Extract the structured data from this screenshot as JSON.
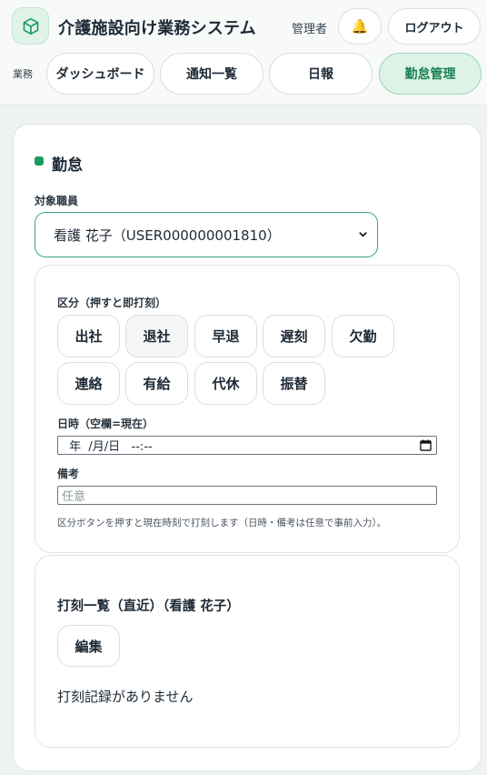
{
  "header": {
    "app_title": "介護施設向け業務システム",
    "role": "管理者",
    "logout_label": "ログアウト",
    "bell_icon": "🔔"
  },
  "nav": {
    "label": "業務",
    "items": [
      {
        "label": "ダッシュボード",
        "active": false
      },
      {
        "label": "通知一覧",
        "active": false
      },
      {
        "label": "日報",
        "active": false
      },
      {
        "label": "勤怠管理",
        "active": true
      }
    ]
  },
  "attendance": {
    "section_title": "勤怠",
    "staff_label": "対象職員",
    "staff_selected": "看護 花子（USER000000001810）",
    "kubun_label": "区分（押すと即打刻）",
    "kubun_buttons": [
      "出社",
      "退社",
      "早退",
      "遅刻",
      "欠勤",
      "連絡",
      "有給",
      "代休",
      "振替"
    ],
    "datetime_label": "日時（空欄=現在）",
    "datetime_value": " 年  /月/日   --:--",
    "memo_label": "備考",
    "memo_placeholder": "任意",
    "hint": "区分ボタンを押すと現在時刻で打刻します（日時・備考は任意で事前入力）。"
  },
  "records": {
    "title": "打刻一覧（直近）（看護 花子）",
    "edit_label": "編集",
    "empty_message": "打刻記録がありません"
  },
  "colors": {
    "accent": "#1a9b63",
    "active_nav_bg": "#def3e8",
    "border": "#d8e0dc"
  }
}
